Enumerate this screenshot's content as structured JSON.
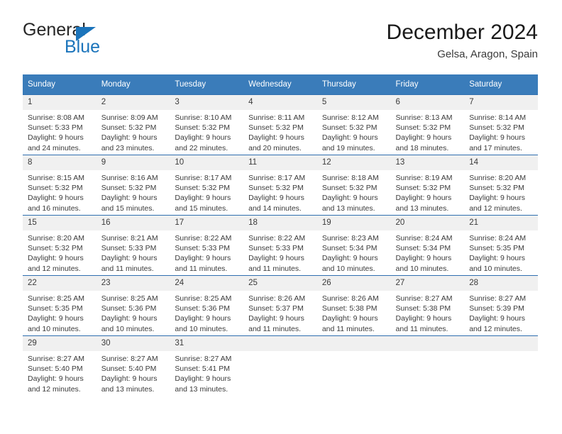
{
  "brand": {
    "name_top": "General",
    "name_bottom": "Blue",
    "accent_color": "#1b74bb"
  },
  "header": {
    "title": "December 2024",
    "subtitle": "Gelsa, Aragon, Spain"
  },
  "calendar": {
    "header_bg": "#3a7cba",
    "daynum_bg": "#f0f0f0",
    "row_border_color": "#2f6fb0",
    "weekdays": [
      "Sunday",
      "Monday",
      "Tuesday",
      "Wednesday",
      "Thursday",
      "Friday",
      "Saturday"
    ],
    "weeks": [
      [
        {
          "day": "1",
          "sunrise": "Sunrise: 8:08 AM",
          "sunset": "Sunset: 5:33 PM",
          "daylight1": "Daylight: 9 hours",
          "daylight2": "and 24 minutes."
        },
        {
          "day": "2",
          "sunrise": "Sunrise: 8:09 AM",
          "sunset": "Sunset: 5:32 PM",
          "daylight1": "Daylight: 9 hours",
          "daylight2": "and 23 minutes."
        },
        {
          "day": "3",
          "sunrise": "Sunrise: 8:10 AM",
          "sunset": "Sunset: 5:32 PM",
          "daylight1": "Daylight: 9 hours",
          "daylight2": "and 22 minutes."
        },
        {
          "day": "4",
          "sunrise": "Sunrise: 8:11 AM",
          "sunset": "Sunset: 5:32 PM",
          "daylight1": "Daylight: 9 hours",
          "daylight2": "and 20 minutes."
        },
        {
          "day": "5",
          "sunrise": "Sunrise: 8:12 AM",
          "sunset": "Sunset: 5:32 PM",
          "daylight1": "Daylight: 9 hours",
          "daylight2": "and 19 minutes."
        },
        {
          "day": "6",
          "sunrise": "Sunrise: 8:13 AM",
          "sunset": "Sunset: 5:32 PM",
          "daylight1": "Daylight: 9 hours",
          "daylight2": "and 18 minutes."
        },
        {
          "day": "7",
          "sunrise": "Sunrise: 8:14 AM",
          "sunset": "Sunset: 5:32 PM",
          "daylight1": "Daylight: 9 hours",
          "daylight2": "and 17 minutes."
        }
      ],
      [
        {
          "day": "8",
          "sunrise": "Sunrise: 8:15 AM",
          "sunset": "Sunset: 5:32 PM",
          "daylight1": "Daylight: 9 hours",
          "daylight2": "and 16 minutes."
        },
        {
          "day": "9",
          "sunrise": "Sunrise: 8:16 AM",
          "sunset": "Sunset: 5:32 PM",
          "daylight1": "Daylight: 9 hours",
          "daylight2": "and 15 minutes."
        },
        {
          "day": "10",
          "sunrise": "Sunrise: 8:17 AM",
          "sunset": "Sunset: 5:32 PM",
          "daylight1": "Daylight: 9 hours",
          "daylight2": "and 15 minutes."
        },
        {
          "day": "11",
          "sunrise": "Sunrise: 8:17 AM",
          "sunset": "Sunset: 5:32 PM",
          "daylight1": "Daylight: 9 hours",
          "daylight2": "and 14 minutes."
        },
        {
          "day": "12",
          "sunrise": "Sunrise: 8:18 AM",
          "sunset": "Sunset: 5:32 PM",
          "daylight1": "Daylight: 9 hours",
          "daylight2": "and 13 minutes."
        },
        {
          "day": "13",
          "sunrise": "Sunrise: 8:19 AM",
          "sunset": "Sunset: 5:32 PM",
          "daylight1": "Daylight: 9 hours",
          "daylight2": "and 13 minutes."
        },
        {
          "day": "14",
          "sunrise": "Sunrise: 8:20 AM",
          "sunset": "Sunset: 5:32 PM",
          "daylight1": "Daylight: 9 hours",
          "daylight2": "and 12 minutes."
        }
      ],
      [
        {
          "day": "15",
          "sunrise": "Sunrise: 8:20 AM",
          "sunset": "Sunset: 5:32 PM",
          "daylight1": "Daylight: 9 hours",
          "daylight2": "and 12 minutes."
        },
        {
          "day": "16",
          "sunrise": "Sunrise: 8:21 AM",
          "sunset": "Sunset: 5:33 PM",
          "daylight1": "Daylight: 9 hours",
          "daylight2": "and 11 minutes."
        },
        {
          "day": "17",
          "sunrise": "Sunrise: 8:22 AM",
          "sunset": "Sunset: 5:33 PM",
          "daylight1": "Daylight: 9 hours",
          "daylight2": "and 11 minutes."
        },
        {
          "day": "18",
          "sunrise": "Sunrise: 8:22 AM",
          "sunset": "Sunset: 5:33 PM",
          "daylight1": "Daylight: 9 hours",
          "daylight2": "and 11 minutes."
        },
        {
          "day": "19",
          "sunrise": "Sunrise: 8:23 AM",
          "sunset": "Sunset: 5:34 PM",
          "daylight1": "Daylight: 9 hours",
          "daylight2": "and 10 minutes."
        },
        {
          "day": "20",
          "sunrise": "Sunrise: 8:24 AM",
          "sunset": "Sunset: 5:34 PM",
          "daylight1": "Daylight: 9 hours",
          "daylight2": "and 10 minutes."
        },
        {
          "day": "21",
          "sunrise": "Sunrise: 8:24 AM",
          "sunset": "Sunset: 5:35 PM",
          "daylight1": "Daylight: 9 hours",
          "daylight2": "and 10 minutes."
        }
      ],
      [
        {
          "day": "22",
          "sunrise": "Sunrise: 8:25 AM",
          "sunset": "Sunset: 5:35 PM",
          "daylight1": "Daylight: 9 hours",
          "daylight2": "and 10 minutes."
        },
        {
          "day": "23",
          "sunrise": "Sunrise: 8:25 AM",
          "sunset": "Sunset: 5:36 PM",
          "daylight1": "Daylight: 9 hours",
          "daylight2": "and 10 minutes."
        },
        {
          "day": "24",
          "sunrise": "Sunrise: 8:25 AM",
          "sunset": "Sunset: 5:36 PM",
          "daylight1": "Daylight: 9 hours",
          "daylight2": "and 10 minutes."
        },
        {
          "day": "25",
          "sunrise": "Sunrise: 8:26 AM",
          "sunset": "Sunset: 5:37 PM",
          "daylight1": "Daylight: 9 hours",
          "daylight2": "and 11 minutes."
        },
        {
          "day": "26",
          "sunrise": "Sunrise: 8:26 AM",
          "sunset": "Sunset: 5:38 PM",
          "daylight1": "Daylight: 9 hours",
          "daylight2": "and 11 minutes."
        },
        {
          "day": "27",
          "sunrise": "Sunrise: 8:27 AM",
          "sunset": "Sunset: 5:38 PM",
          "daylight1": "Daylight: 9 hours",
          "daylight2": "and 11 minutes."
        },
        {
          "day": "28",
          "sunrise": "Sunrise: 8:27 AM",
          "sunset": "Sunset: 5:39 PM",
          "daylight1": "Daylight: 9 hours",
          "daylight2": "and 12 minutes."
        }
      ],
      [
        {
          "day": "29",
          "sunrise": "Sunrise: 8:27 AM",
          "sunset": "Sunset: 5:40 PM",
          "daylight1": "Daylight: 9 hours",
          "daylight2": "and 12 minutes."
        },
        {
          "day": "30",
          "sunrise": "Sunrise: 8:27 AM",
          "sunset": "Sunset: 5:40 PM",
          "daylight1": "Daylight: 9 hours",
          "daylight2": "and 13 minutes."
        },
        {
          "day": "31",
          "sunrise": "Sunrise: 8:27 AM",
          "sunset": "Sunset: 5:41 PM",
          "daylight1": "Daylight: 9 hours",
          "daylight2": "and 13 minutes."
        },
        {
          "day": "",
          "sunrise": "",
          "sunset": "",
          "daylight1": "",
          "daylight2": ""
        },
        {
          "day": "",
          "sunrise": "",
          "sunset": "",
          "daylight1": "",
          "daylight2": ""
        },
        {
          "day": "",
          "sunrise": "",
          "sunset": "",
          "daylight1": "",
          "daylight2": ""
        },
        {
          "day": "",
          "sunrise": "",
          "sunset": "",
          "daylight1": "",
          "daylight2": ""
        }
      ]
    ]
  }
}
